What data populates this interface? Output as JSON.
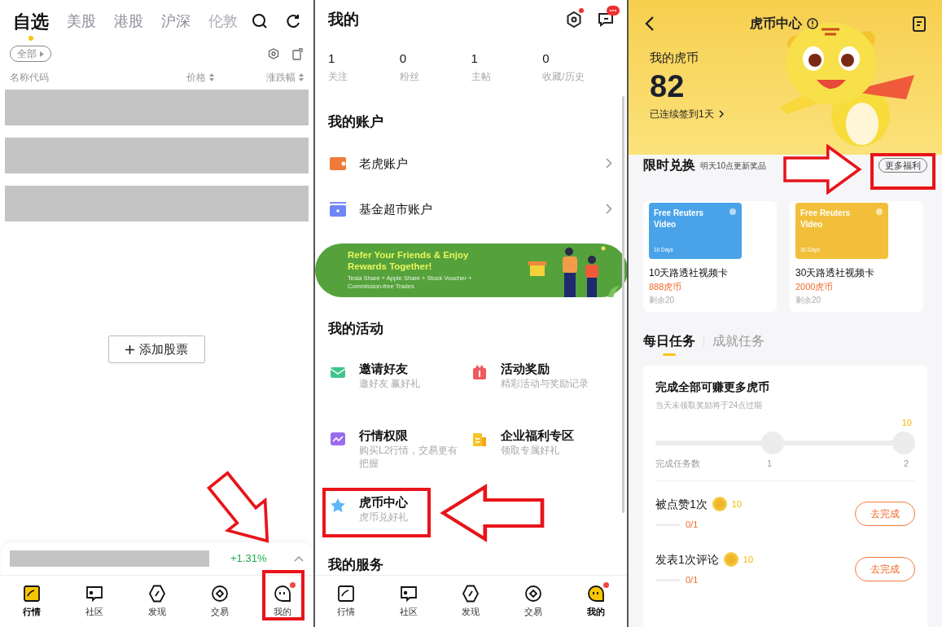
{
  "watchlist": {
    "tabs": [
      {
        "label": "自选",
        "selected": true,
        "dimmed": false
      },
      {
        "label": "美股",
        "selected": false,
        "dimmed": false
      },
      {
        "label": "港股",
        "selected": false,
        "dimmed": false
      },
      {
        "label": "沪深",
        "selected": false,
        "dimmed": false
      },
      {
        "label": "伦敦",
        "selected": false,
        "dimmed": true
      }
    ],
    "filter": "全部",
    "columns": [
      {
        "label": "名称代码",
        "sortable": false
      },
      {
        "label": "价格",
        "sortable": true
      },
      {
        "label": "涨跌幅",
        "sortable": true
      }
    ],
    "rows": [
      {
        "redacted": true
      },
      {
        "redacted": true
      },
      {
        "redacted": true
      }
    ],
    "add_button": "添加股票",
    "ticker": {
      "redacted": true,
      "change": "+1.31%"
    },
    "nav": [
      {
        "label": "行情",
        "selected": true,
        "badge": false
      },
      {
        "label": "社区",
        "selected": false,
        "badge": false
      },
      {
        "label": "发现",
        "selected": false,
        "badge": false
      },
      {
        "label": "交易",
        "selected": false,
        "badge": false
      },
      {
        "label": "我的",
        "selected": false,
        "badge": true
      }
    ]
  },
  "profile": {
    "title": "我的",
    "settings_badge": true,
    "messages_badge": true,
    "stats": [
      {
        "value": "1",
        "label": "关注"
      },
      {
        "value": "0",
        "label": "粉丝"
      },
      {
        "value": "1",
        "label": "主帖"
      },
      {
        "value": "0",
        "label": "收藏/历史"
      }
    ],
    "accounts": {
      "title": "我的账户",
      "items": [
        {
          "label": "老虎账户"
        },
        {
          "label": "基金超市账户"
        }
      ]
    },
    "banner": {
      "title": "Refer Your Friends & Enjoy Rewards Together!",
      "subtitle": "Tesla Share + Apple Share + Stock Voucher + Commission-free Trades"
    },
    "activities": {
      "title": "我的活动",
      "items": [
        {
          "title": "邀请好友",
          "subtitle": "邀好友 赢好礼"
        },
        {
          "title": "活动奖励",
          "subtitle": "精彩活动与奖励记录"
        },
        {
          "title": "行情权限",
          "subtitle": "购买L2行情，交易更有把握"
        },
        {
          "title": "企业福利专区",
          "subtitle": "领取专属好礼"
        },
        {
          "title": "虎币中心",
          "subtitle": "虎币兑好礼"
        }
      ]
    },
    "services": {
      "title": "我的服务"
    },
    "nav": [
      {
        "label": "行情",
        "selected": false,
        "badge": false
      },
      {
        "label": "社区",
        "selected": false,
        "badge": false
      },
      {
        "label": "发现",
        "selected": false,
        "badge": false
      },
      {
        "label": "交易",
        "selected": false,
        "badge": false
      },
      {
        "label": "我的",
        "selected": true,
        "badge": true
      }
    ]
  },
  "coin_center": {
    "title": "虎币中心",
    "balance_label": "我的虎币",
    "balance": "82",
    "streak": "已连续签到1天",
    "exchange": {
      "title": "限时兑换",
      "note": "明天10点更新奖品",
      "more": "更多福利",
      "rewards": [
        {
          "card_title": "Free Reuters Video",
          "duration": "10 Days",
          "color": "#4aa3e8",
          "name": "10天路透社视频卡",
          "price": "888虎币",
          "remaining": "剩余20"
        },
        {
          "card_title": "Free Reuters Video",
          "duration": "30 Days",
          "color": "#f2bf3a",
          "name": "30天路透社视频卡",
          "price": "2000虎币",
          "remaining": "剩余20"
        }
      ]
    },
    "task_tabs": [
      {
        "label": "每日任务",
        "selected": true
      },
      {
        "label": "成就任务",
        "selected": false
      }
    ],
    "bonus": {
      "title": "完成全部可赚更多虎币",
      "note": "当天未领取奖励将于24点过期",
      "level": 0,
      "goal_reward": "10",
      "axis_label": "完成任务数",
      "steps": [
        "1",
        "2"
      ]
    },
    "tasks": [
      {
        "title": "被点赞1次",
        "reward": "10",
        "progress": "0/1",
        "level": 0,
        "button": "去完成"
      },
      {
        "title": "发表1次评论",
        "reward": "10",
        "progress": "0/1",
        "level": 0,
        "button": "去完成"
      }
    ]
  }
}
